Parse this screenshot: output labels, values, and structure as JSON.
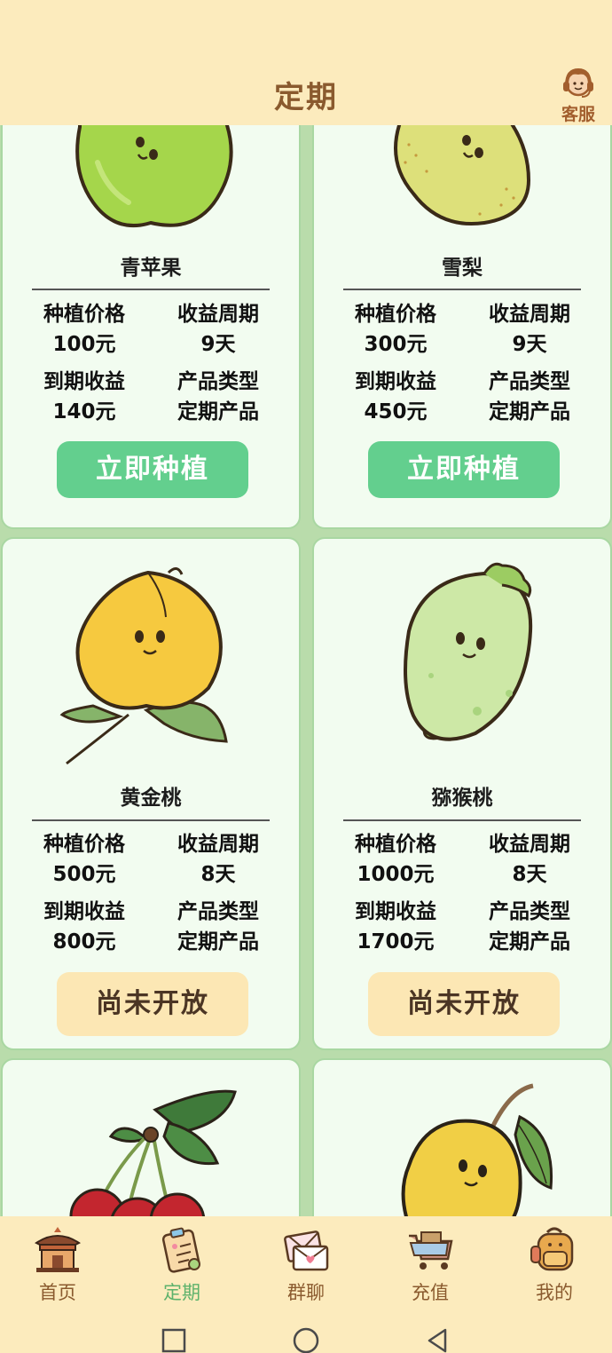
{
  "header": {
    "title": "定期",
    "support_label": "客服"
  },
  "products": [
    {
      "name": "青苹果",
      "price_label": "种植价格",
      "price": "100元",
      "cycle_label": "收益周期",
      "cycle": "9天",
      "return_label": "到期收益",
      "return_value": "140元",
      "type_label": "产品类型",
      "type_value": "定期产品",
      "button": "立即种植",
      "button_state": "open",
      "icon": "green-apple-icon"
    },
    {
      "name": "雪梨",
      "price_label": "种植价格",
      "price": "300元",
      "cycle_label": "收益周期",
      "cycle": "9天",
      "return_label": "到期收益",
      "return_value": "450元",
      "type_label": "产品类型",
      "type_value": "定期产品",
      "button": "立即种植",
      "button_state": "open",
      "icon": "pear-icon"
    },
    {
      "name": "黄金桃",
      "price_label": "种植价格",
      "price": "500元",
      "cycle_label": "收益周期",
      "cycle": "8天",
      "return_label": "到期收益",
      "return_value": "800元",
      "type_label": "产品类型",
      "type_value": "定期产品",
      "button": "尚未开放",
      "button_state": "closed",
      "icon": "peach-icon"
    },
    {
      "name": "猕猴桃",
      "price_label": "种植价格",
      "price": "1000元",
      "cycle_label": "收益周期",
      "cycle": "8天",
      "return_label": "到期收益",
      "return_value": "1700元",
      "type_label": "产品类型",
      "type_value": "定期产品",
      "button": "尚未开放",
      "button_state": "closed",
      "icon": "kiwi-icon"
    }
  ],
  "partial_cards": [
    {
      "icon": "cherry-icon"
    },
    {
      "icon": "mango-icon"
    }
  ],
  "tabs": [
    {
      "label": "首页",
      "icon": "home-pavilion-icon",
      "active": false
    },
    {
      "label": "定期",
      "icon": "clipboard-icon",
      "active": true
    },
    {
      "label": "群聊",
      "icon": "envelope-hearts-icon",
      "active": false
    },
    {
      "label": "充值",
      "icon": "cart-icon",
      "active": false
    },
    {
      "label": "我的",
      "icon": "backpack-icon",
      "active": false
    }
  ],
  "colors": {
    "header_bg": "#fcebbd",
    "page_bg": "#b9dcab",
    "card_bg": "#f2fcf0",
    "plant_button": "#63cf8e",
    "closed_button": "#fce7b4",
    "title_brown": "#8a5a2e",
    "active_tab": "#5db26b"
  }
}
